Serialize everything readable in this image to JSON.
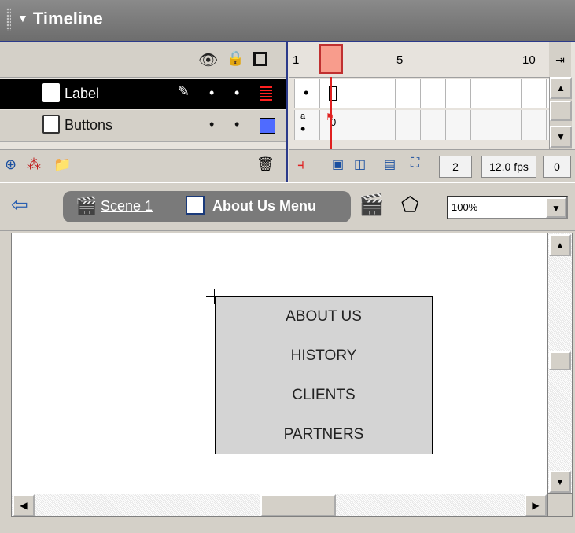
{
  "panel": {
    "title": "Timeline"
  },
  "timeline": {
    "layers": [
      {
        "name": "Label",
        "selected": true,
        "color": "#ff0000"
      },
      {
        "name": "Buttons",
        "selected": false,
        "color": "#4f6bff"
      }
    ],
    "ruler": {
      "labels": [
        "1",
        "5",
        "10"
      ]
    },
    "frame_labels": {
      "label_row": "0",
      "buttons_row": "a"
    },
    "current_frame": "2",
    "fps": "12.0 fps",
    "elapsed": "0"
  },
  "editbar": {
    "scene": "Scene 1",
    "symbol": "About Us Menu",
    "zoom": "100%"
  },
  "stage": {
    "menu_items": [
      "ABOUT US",
      "HISTORY",
      "CLIENTS",
      "PARTNERS"
    ]
  },
  "colors": {
    "titlebar": "#7a7a7a",
    "playhead": "#f89c8c",
    "layer_selected": "#000000",
    "stage": "#ffffff"
  }
}
